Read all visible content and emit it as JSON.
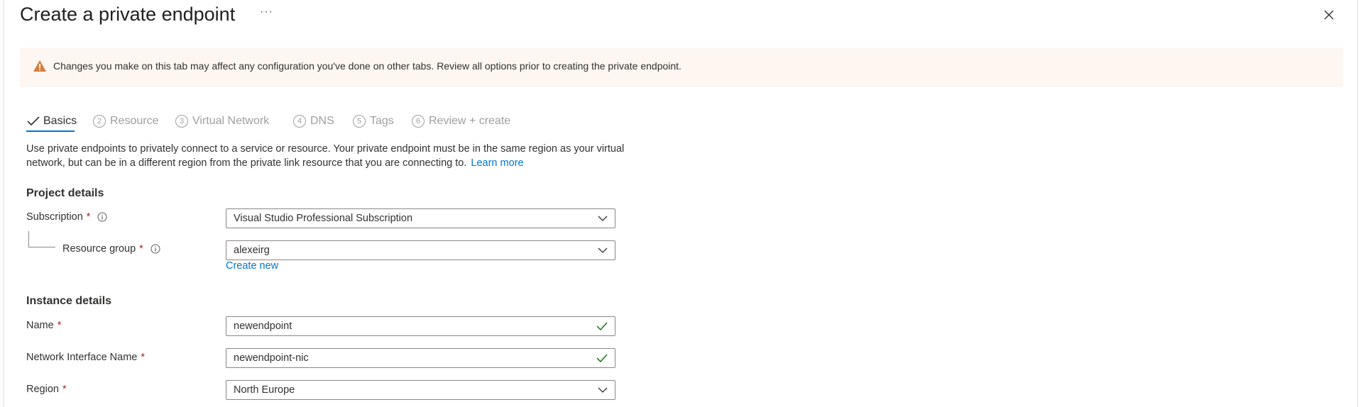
{
  "header": {
    "title": "Create a private endpoint",
    "more_label": "···"
  },
  "banner": {
    "message": "Changes you make on this tab may affect any configuration you've done on other tabs. Review all options prior to creating the private endpoint.",
    "icon": "warning-icon",
    "color": "#d67f3c"
  },
  "tabs": [
    {
      "number": "",
      "label": "Basics",
      "state": "completed-active"
    },
    {
      "number": "2",
      "label": "Resource"
    },
    {
      "number": "3",
      "label": "Virtual Network"
    },
    {
      "number": "4",
      "label": "DNS"
    },
    {
      "number": "5",
      "label": "Tags"
    },
    {
      "number": "6",
      "label": "Review + create"
    }
  ],
  "intro": {
    "text": "Use private endpoints to privately connect to a service or resource. Your private endpoint must be in the same region as your virtual network, but can be in a different region from the private link resource that you are connecting to.",
    "link": "Learn more"
  },
  "project": {
    "heading": "Project details",
    "subscription_label": "Subscription",
    "subscription_value": "Visual Studio Professional Subscription",
    "resource_group_label": "Resource group",
    "resource_group_value": "alexeirg",
    "create_new": "Create new"
  },
  "instance": {
    "heading": "Instance details",
    "name_label": "Name",
    "name_value": "newendpoint",
    "nic_label": "Network Interface Name",
    "nic_value": "newendpoint-nic",
    "region_label": "Region",
    "region_value": "North Europe"
  },
  "required_marker": "*",
  "colors": {
    "accent": "#0078d4",
    "required": "#a4262c",
    "valid": "#107c10",
    "banner_bg": "#fdf6f1"
  }
}
